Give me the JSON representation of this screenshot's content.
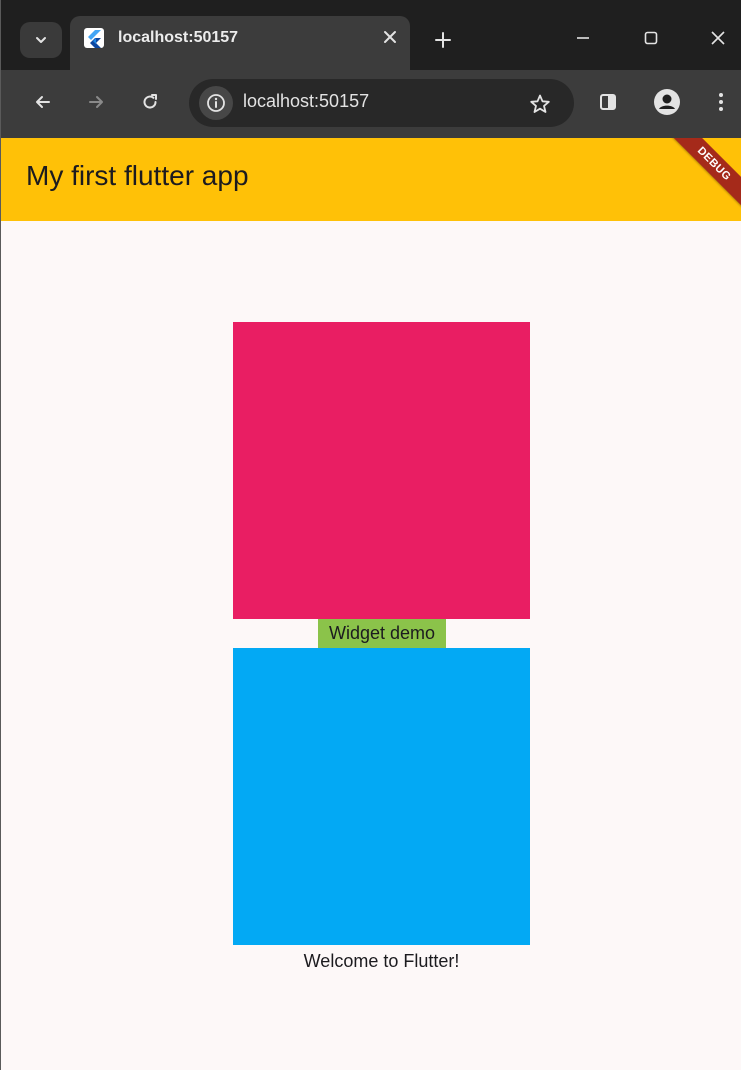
{
  "browser": {
    "tab": {
      "title": "localhost:50157",
      "favicon": "flutter-icon"
    },
    "address_bar": {
      "url": "localhost:50157"
    },
    "icons": {
      "tab_search": "chevron-down-icon",
      "close_tab": "close-icon",
      "new_tab": "plus-icon",
      "minimize": "minimize-icon",
      "maximize": "maximize-icon",
      "close_window": "close-icon",
      "back": "arrow-left-icon",
      "forward": "arrow-right-icon",
      "reload": "reload-icon",
      "site_info": "info-icon",
      "bookmark": "star-icon",
      "side_panel": "side-panel-icon",
      "profile": "profile-icon",
      "menu": "kebab-menu-icon"
    }
  },
  "app": {
    "title": "My first flutter app",
    "debug_banner": "DEBUG",
    "top_box_label": "Widget demo",
    "bottom_box_label": "Welcome to Flutter!",
    "colors": {
      "appbar": "#ffc107",
      "background": "#fdf8f8",
      "top_box": "#e91e63",
      "bottom_box": "#03a9f4",
      "label_background": "#8bc34a",
      "debug_banner": "#a52a1a"
    }
  }
}
